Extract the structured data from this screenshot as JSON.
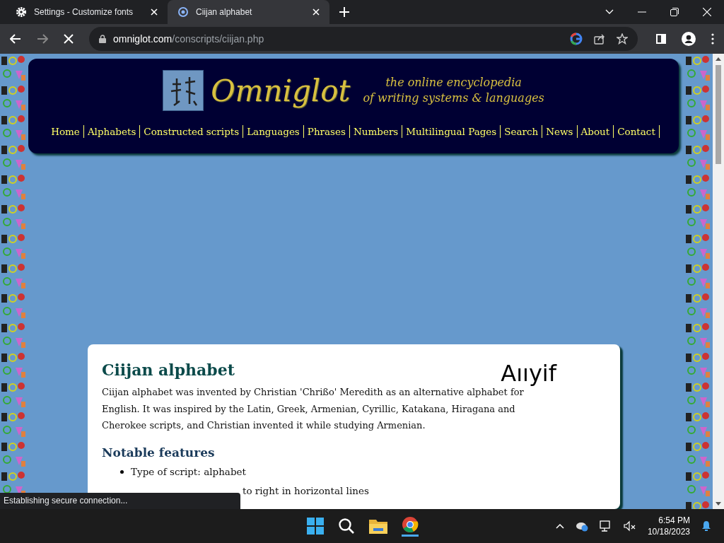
{
  "tabs": [
    {
      "title": "Settings - Customize fonts",
      "kind": "settings",
      "selected": false
    },
    {
      "title": "Ciijan alphabet",
      "kind": "site",
      "selected": true
    }
  ],
  "address": {
    "domain": "omniglot.com",
    "path": "/conscripts/ciijan.php"
  },
  "site": {
    "logo": "Omniglot",
    "tagline": [
      "the online encyclopedia",
      "of writing systems & languages"
    ],
    "nav": [
      "Home",
      "Alphabets",
      "Constructed scripts",
      "Languages",
      "Phrases",
      "Numbers",
      "Multilingual Pages",
      "Search",
      "News",
      "About",
      "Contact"
    ]
  },
  "article": {
    "title": "Ciijan alphabet",
    "sample": "Aııyif",
    "intro": "Ciijan alphabet was invented by Christian 'Chrißo' Meredith as an alternative alphabet for English. It was inspired by the Latin, Greek, Armenian, Cyrillic, Katakana, Hiragana and Cherokee scripts, and Christian invented it while studying Armenian.",
    "section": "Notable features",
    "bullets": [
      {
        "text": "Type of script: alphabet"
      },
      {
        "text": "to right in horizontal lines",
        "covered": true
      }
    ]
  },
  "status": "Establishing secure connection...",
  "taskbar": {
    "time": "6:54 PM",
    "date": "10/18/2023"
  }
}
